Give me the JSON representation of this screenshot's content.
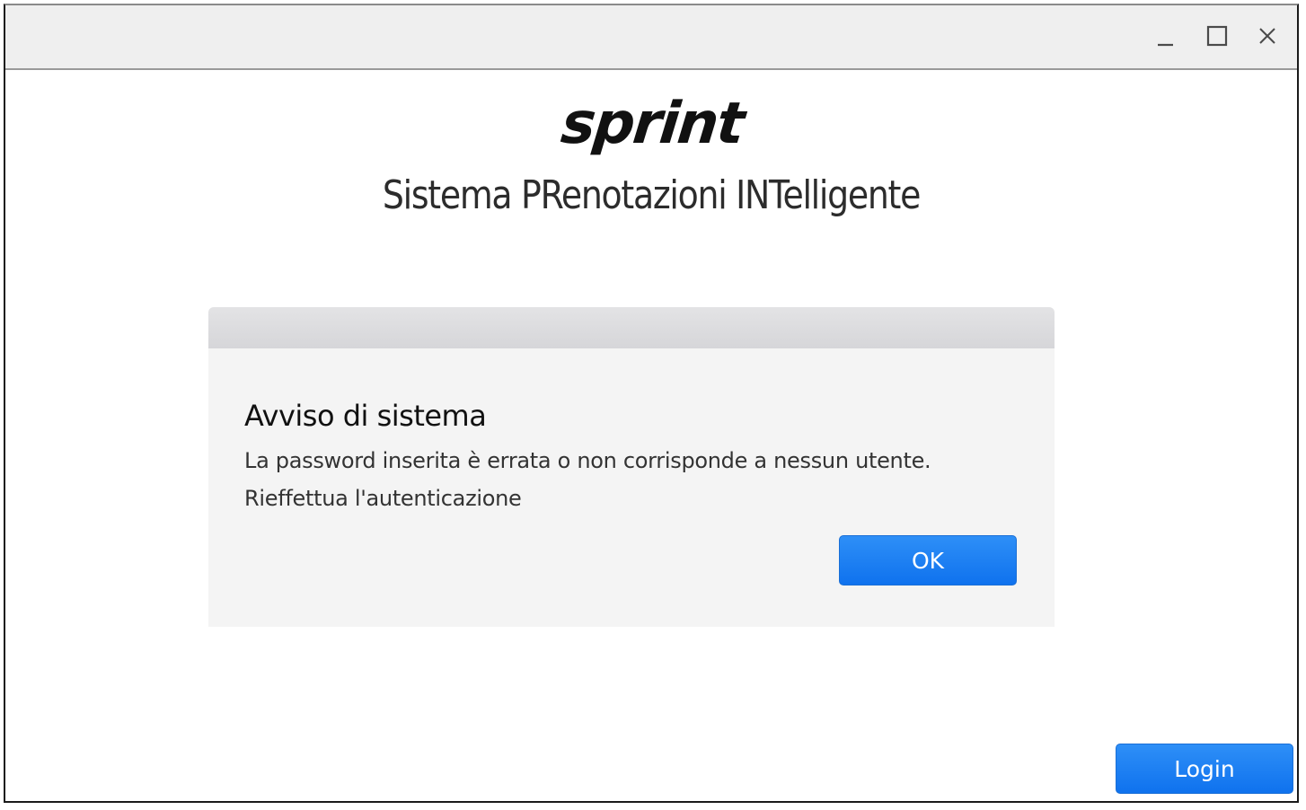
{
  "window": {
    "controls": {
      "minimize_icon": "minimize-icon",
      "maximize_icon": "maximize-icon",
      "close_icon": "close-icon"
    }
  },
  "header": {
    "logo_text": "sprint",
    "app_title": "Sistema PRenotazioni INTelligente"
  },
  "dialog": {
    "title": "Avviso di sistema",
    "message_line1": "La password inserita è errata o non corrisponde a nessun utente.",
    "message_line2": "Rieffettua l'autenticazione",
    "ok_label": "OK"
  },
  "footer": {
    "login_label": "Login"
  },
  "colors": {
    "accent": "#0f72ee",
    "titlebar": "#efefef",
    "dialog_bg": "#f4f4f4"
  }
}
